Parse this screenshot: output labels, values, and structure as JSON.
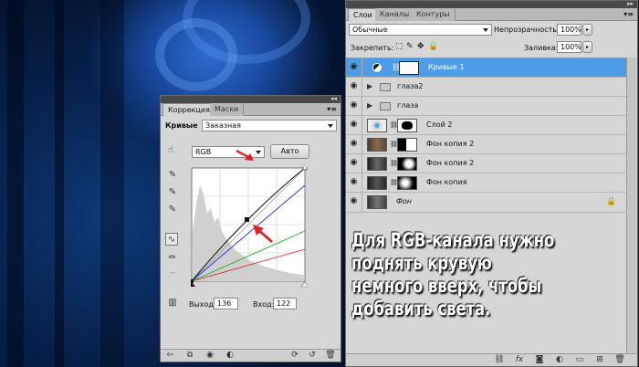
{
  "corrections": {
    "tabs": [
      {
        "label": "Коррекция"
      },
      {
        "label": "Маски"
      }
    ],
    "preset_label": "Кривые",
    "preset_value": "Заказная",
    "channel_value": "RGB",
    "auto_button": "Авто",
    "output_label": "Выход:",
    "output_value": "136",
    "input_label": "Вход:",
    "input_value": "122"
  },
  "layers_panel": {
    "tabs": [
      {
        "label": "Слои"
      },
      {
        "label": "Каналы"
      },
      {
        "label": "Контуры"
      }
    ],
    "blend_mode": "Обычные",
    "opacity_label": "Непрозрачность:",
    "opacity_value": "100%",
    "lock_label": "Закрепить:",
    "fill_label": "Заливка:",
    "fill_value": "100%",
    "layers": [
      {
        "name": "Кривые 1",
        "type": "adjustment",
        "selected": true
      },
      {
        "name": "глаза2",
        "type": "group"
      },
      {
        "name": "глаза",
        "type": "group"
      },
      {
        "name": "Слой 2",
        "type": "layer-mask"
      },
      {
        "name": "Фон копия 2",
        "type": "layer-mask"
      },
      {
        "name": "Фон копия 2",
        "type": "layer-mask"
      },
      {
        "name": "Фон копия",
        "type": "layer-mask"
      },
      {
        "name": "Фон",
        "type": "background",
        "locked": true
      }
    ]
  },
  "caption": "Для RGB-канала нужно поднять крувую немного вверх, чтобы добавить света.",
  "curve": {
    "control_point": {
      "input": 122,
      "output": 136
    }
  },
  "colors": {
    "selection": "#4d9ce8",
    "arrow": "#e02020",
    "panel_bg": "#d6d6d6"
  }
}
